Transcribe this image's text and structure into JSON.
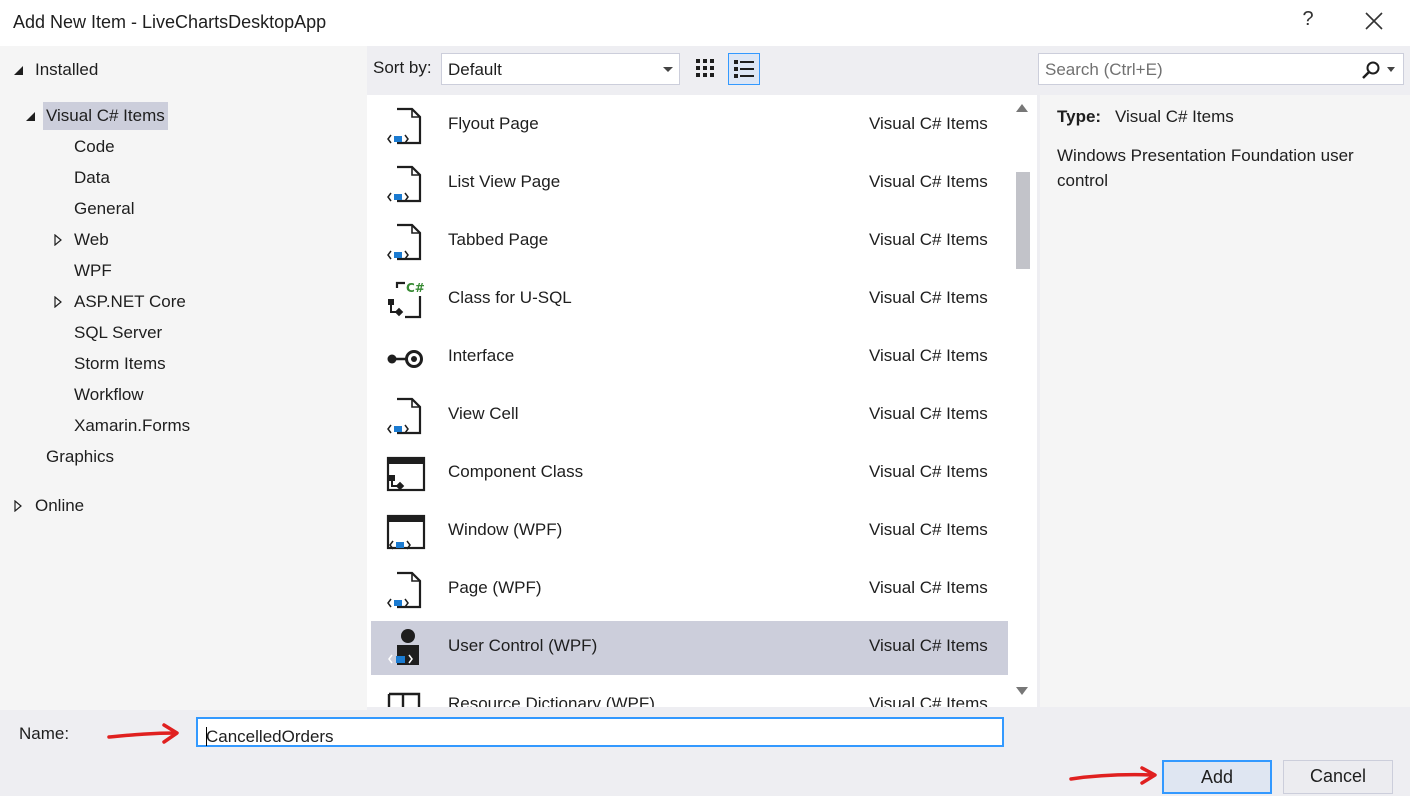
{
  "window": {
    "title": "Add New Item - LiveChartsDesktopApp",
    "help_label": "?"
  },
  "tree": {
    "installed": "Installed",
    "visual_csharp_items": "Visual C# Items",
    "children": [
      "Code",
      "Data",
      "General",
      "Web",
      "WPF",
      "ASP.NET Core",
      "SQL Server",
      "Storm Items",
      "Workflow",
      "Xamarin.Forms"
    ],
    "graphics": "Graphics",
    "online": "Online"
  },
  "toolbar": {
    "sort_label": "Sort by:",
    "sort_value": "Default",
    "search_placeholder": "Search (Ctrl+E)"
  },
  "templates": [
    {
      "name": "Flyout Page",
      "category": "Visual C# Items",
      "icon": "page-icon"
    },
    {
      "name": "List View Page",
      "category": "Visual C# Items",
      "icon": "page-icon"
    },
    {
      "name": "Tabbed Page",
      "category": "Visual C# Items",
      "icon": "page-icon"
    },
    {
      "name": "Class for U-SQL",
      "category": "Visual C# Items",
      "icon": "csharp-class-icon"
    },
    {
      "name": "Interface",
      "category": "Visual C# Items",
      "icon": "interface-icon"
    },
    {
      "name": "View Cell",
      "category": "Visual C# Items",
      "icon": "page-icon"
    },
    {
      "name": "Component Class",
      "category": "Visual C# Items",
      "icon": "component-icon"
    },
    {
      "name": "Window (WPF)",
      "category": "Visual C# Items",
      "icon": "window-icon"
    },
    {
      "name": "Page (WPF)",
      "category": "Visual C# Items",
      "icon": "page-icon"
    },
    {
      "name": "User Control (WPF)",
      "category": "Visual C# Items",
      "icon": "user-control-icon",
      "selected": true
    },
    {
      "name": "Resource Dictionary (WPF)",
      "category": "Visual C# Items",
      "icon": "book-icon"
    }
  ],
  "details": {
    "type_label": "Type:",
    "type_value": "Visual C# Items",
    "description": "Windows Presentation Foundation user control"
  },
  "bottom": {
    "name_label": "Name:",
    "name_value": "CancelledOrders",
    "add_label": "Add",
    "cancel_label": "Cancel"
  },
  "colors": {
    "selection": "#cccedb",
    "focus": "#3399ff",
    "annotation_arrow": "#e02020"
  }
}
